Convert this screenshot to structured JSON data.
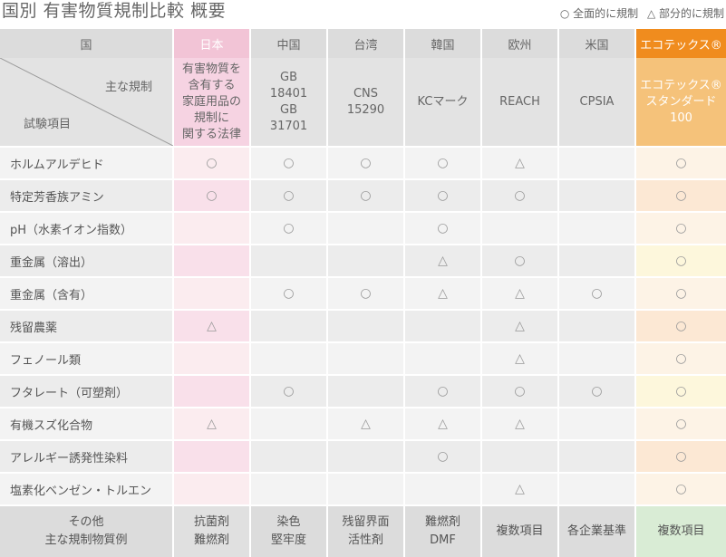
{
  "title": "国別 有害物質規制比較 概要",
  "legend": {
    "full": "○ 全面的に規制",
    "partial": "△ 部分的に規制"
  },
  "header": {
    "first": "国",
    "countries": [
      "日本",
      "中国",
      "台湾",
      "韓国",
      "欧州",
      "米国",
      "エコテックス®"
    ]
  },
  "sub": {
    "top_label": "主な規制",
    "bottom_label": "試験項目",
    "regs": [
      [
        "有害物質を",
        "含有する",
        "家庭用品の",
        "規制に",
        "関する法律"
      ],
      [
        "GB",
        "18401",
        "GB",
        "31701"
      ],
      [
        "CNS",
        "15290"
      ],
      [
        "KCマーク"
      ],
      [
        "REACH"
      ],
      [
        "CPSIA"
      ],
      [
        "エコテックス®",
        "スタンダード",
        "100"
      ]
    ]
  },
  "rows": [
    {
      "item": "ホルムアルデヒド",
      "marks": [
        "○",
        "○",
        "○",
        "○",
        "△",
        "",
        "○"
      ]
    },
    {
      "item": "特定芳香族アミン",
      "marks": [
        "○",
        "○",
        "○",
        "○",
        "○",
        "",
        "○"
      ]
    },
    {
      "item": "pH（水素イオン指数）",
      "marks": [
        "",
        "○",
        "",
        "○",
        "",
        "",
        "○"
      ]
    },
    {
      "item": "重金属（溶出）",
      "marks": [
        "",
        "",
        "",
        "△",
        "○",
        "",
        "○"
      ]
    },
    {
      "item": "重金属（含有）",
      "marks": [
        "",
        "○",
        "○",
        "△",
        "△",
        "○",
        "○"
      ]
    },
    {
      "item": "残留農薬",
      "marks": [
        "△",
        "",
        "",
        "",
        "△",
        "",
        "○"
      ]
    },
    {
      "item": "フェノール類",
      "marks": [
        "",
        "",
        "",
        "",
        "△",
        "",
        "○"
      ]
    },
    {
      "item": "フタレート（可塑剤）",
      "marks": [
        "",
        "○",
        "",
        "○",
        "○",
        "○",
        "○"
      ]
    },
    {
      "item": "有機スズ化合物",
      "marks": [
        "△",
        "",
        "△",
        "△",
        "△",
        "",
        "○"
      ]
    },
    {
      "item": "アレルギー誘発性染料",
      "marks": [
        "",
        "",
        "",
        "○",
        "",
        "",
        "○"
      ]
    },
    {
      "item": "塩素化ベンゼン・トルエン",
      "marks": [
        "",
        "",
        "",
        "",
        "△",
        "",
        "○"
      ]
    }
  ],
  "footer": {
    "label": [
      "その他",
      "主な規制物質例"
    ],
    "values": [
      [
        "抗菌剤",
        "難燃剤"
      ],
      [
        "染色",
        "堅牢度"
      ],
      [
        "残留界面",
        "活性剤"
      ],
      [
        "難燃剤",
        "DMF"
      ],
      [
        "複数項目"
      ],
      [
        "各企業基準"
      ],
      [
        "複数項目"
      ]
    ]
  }
}
